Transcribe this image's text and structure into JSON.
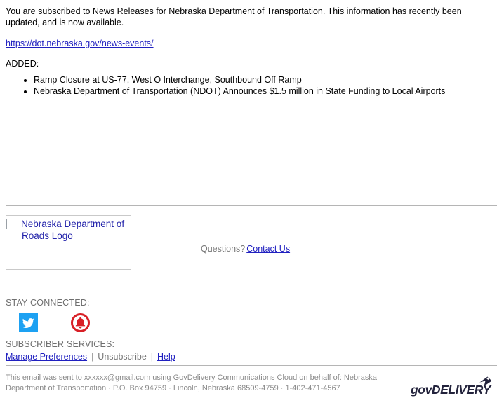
{
  "message": {
    "intro": "You are subscribed to News Releases for Nebraska Department of Transportation. This information has recently been updated, and is now available.",
    "source_url": "https://dot.nebraska.gov/news-events/",
    "added_label": "ADDED:",
    "added_items": [
      "Ramp Closure at US-77, West O Interchange, Southbound Off Ramp",
      "Nebraska Department of Transportation (NDOT) Announces $1.5 million in State Funding to Local Airports"
    ]
  },
  "footer": {
    "logo_alt_text": "Nebraska Department of Roads Logo",
    "logo_icon": "broken-image-icon",
    "questions_label": "Questions?",
    "contact_link": "Contact Us",
    "stay_connected_label": "STAY CONNECTED:",
    "social_icons": [
      {
        "name": "twitter-icon",
        "label": "Twitter"
      },
      {
        "name": "bell-icon",
        "label": "Notifications"
      }
    ],
    "subscriber_services_label": "SUBSCRIBER SERVICES:",
    "links": {
      "manage_preferences": "Manage Preferences",
      "unsubscribe": "Unsubscribe",
      "help": "Help",
      "separator": "|"
    }
  },
  "bottom_bar": {
    "disclaimer": "This email was sent to xxxxxx@gmail.com using GovDelivery Communications Cloud on behalf of: Nebraska Department of Transportation · P.O. Box 94759 · Lincoln, Nebraska 68509-4759 · 1-402-471-4567",
    "brand_name": "govDELIVERY",
    "brand_icon": "winged-envelope-icon"
  },
  "colors": {
    "link": "#2020c0",
    "muted_text": "#777777",
    "divider": "#b5b5b5",
    "twitter_blue": "#1da1f2",
    "bell_red": "#d81f26",
    "brand_navy": "#23233c",
    "alt_text_blue": "#2222aa"
  }
}
